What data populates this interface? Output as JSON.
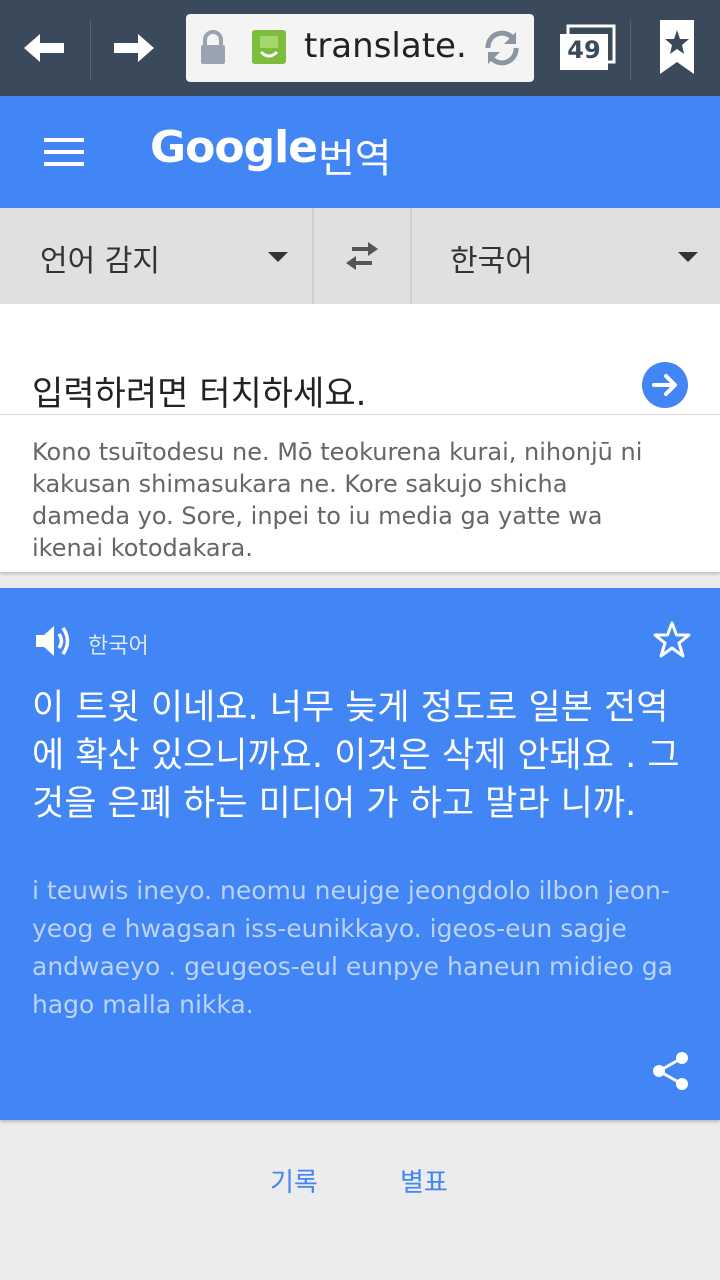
{
  "browser": {
    "url": "translate.g",
    "tab_count": "49"
  },
  "header": {
    "logo": "Google",
    "title": "번역"
  },
  "languages": {
    "source": "언어 감지",
    "target": "한국어"
  },
  "input": {
    "placeholder": "입력하려면 터치하세요.",
    "source_romanization": "Kono tsuītodesu ne. Mō teokurena kurai, nihonjū ni kakusan shimasukara ne. Kore sakujo shicha dameda yo. Sore, inpei to iu media ga yatte wa ikenai kotodakara."
  },
  "result": {
    "language": "한국어",
    "translation": "이 트윗 이네요. 너무 늦게 정도로 일본 전역 에 확산 있으니까요. 이것은 삭제 안돼요 . 그것을 은폐 하는 미디어 가 하고 말라 니까.",
    "romanization": "i teuwis ineyo. neomu neujge jeongdolo ilbon jeon-yeog e hwagsan iss-eunikkayo. igeos-eun sagje andwaeyo . geugeos-eul eunpye haneun midieo ga hago malla nikka."
  },
  "bottom": {
    "history": "기록",
    "starred": "별표"
  },
  "colors": {
    "browser_bar": "#3b4a5a",
    "accent": "#4285f4"
  }
}
